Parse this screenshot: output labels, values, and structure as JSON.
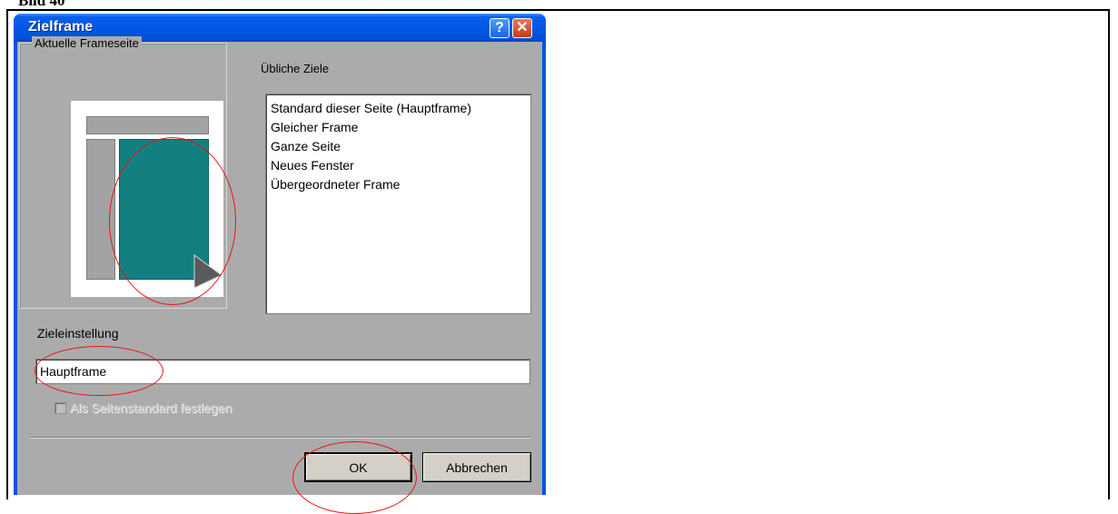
{
  "document": {
    "caption": "Bild 40"
  },
  "dialog": {
    "title": "Zielframe",
    "help_glyph": "?",
    "close_glyph": "✕",
    "current_frame_group_label": "Aktuelle Frameseite",
    "common_targets_label": "Übliche Ziele",
    "common_targets": [
      "Standard dieser Seite (Hauptframe)",
      "Gleicher Frame",
      "Ganze Seite",
      "Neues Fenster",
      "Übergeordneter Frame"
    ],
    "target_setting_label": "Zieleinstellung",
    "target_setting_value": "Hauptframe",
    "set_default_checkbox_label": "Als Seitenstandard festlegen",
    "set_default_checked": false,
    "ok_label": "OK",
    "cancel_label": "Abbrechen"
  },
  "colors": {
    "titlebar": "#0058e6",
    "dialog_body": "#ababab",
    "selected_frame": "#128080",
    "annotation": "#e81515"
  },
  "icons": [
    "help-icon",
    "close-icon",
    "mouse-pointer-icon",
    "checkbox-icon"
  ]
}
